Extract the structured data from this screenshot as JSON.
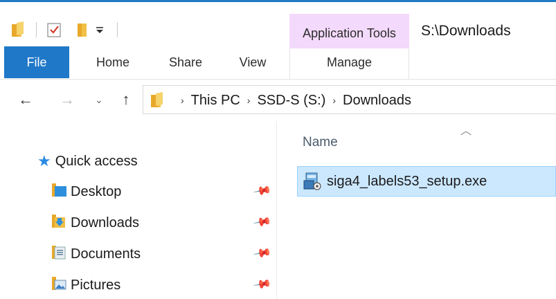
{
  "window": {
    "title": "S:\\Downloads",
    "context_tab_label": "Application Tools"
  },
  "quick_access_toolbar": {
    "icons": [
      "folder-icon",
      "properties-check-icon",
      "new-folder-icon",
      "customize-dropdown-icon"
    ]
  },
  "ribbon": {
    "tabs": {
      "file": "File",
      "home": "Home",
      "share": "Share",
      "view": "View",
      "manage": "Manage"
    }
  },
  "navigation": {
    "back": "←",
    "forward": "→",
    "recent": "⌄",
    "up": "↑"
  },
  "address": {
    "crumbs": [
      "This PC",
      "SSD-S (S:)",
      "Downloads"
    ],
    "separator": "›"
  },
  "nav_pane": {
    "quick_access": "Quick access",
    "items": [
      {
        "label": "Desktop",
        "icon": "desktop-folder-icon"
      },
      {
        "label": "Downloads",
        "icon": "downloads-folder-icon"
      },
      {
        "label": "Documents",
        "icon": "documents-folder-icon"
      },
      {
        "label": "Pictures",
        "icon": "pictures-folder-icon"
      }
    ]
  },
  "file_list": {
    "column_name": "Name",
    "files": [
      {
        "name": "siga4_labels53_setup.exe",
        "icon": "installer-exe-icon",
        "selected": true
      }
    ]
  },
  "colors": {
    "accent": "#1f78c8",
    "context_tab": "#f3d9fb",
    "selection": "#cce8ff",
    "selection_border": "#99d1ff",
    "folder": "#f2c046"
  }
}
